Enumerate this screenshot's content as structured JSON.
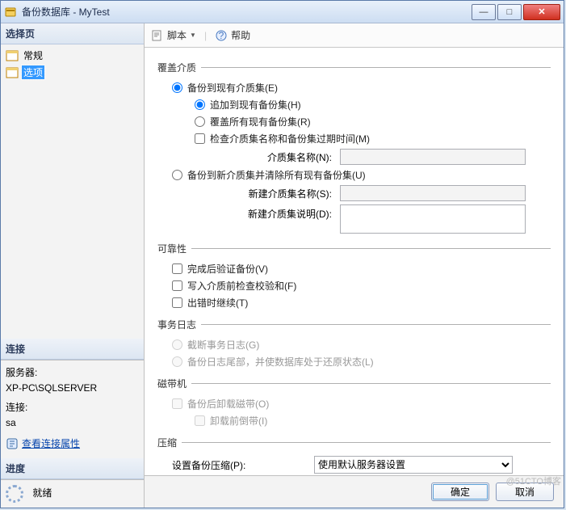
{
  "window": {
    "title": "备份数据库 - MyTest"
  },
  "sidebar": {
    "select_page": "选择页",
    "items": [
      {
        "label": "常规"
      },
      {
        "label": "选项"
      }
    ],
    "connection_hdr": "连接",
    "server_label": "服务器:",
    "server_value": "XP-PC\\SQLSERVER",
    "conn_label": "连接:",
    "conn_value": "sa",
    "view_props": "查看连接属性",
    "progress_hdr": "进度",
    "progress_status": "就绪"
  },
  "toolbar": {
    "script": "脚本",
    "help": "帮助"
  },
  "groups": {
    "overwrite": {
      "legend": "覆盖介质",
      "r_existing": "备份到现有介质集(E)",
      "r_append": "追加到现有备份集(H)",
      "r_overwrite_all": "覆盖所有现有备份集(R)",
      "chk_check_name": "检查介质集名称和备份集过期时间(M)",
      "lbl_media_name": "介质集名称(N):",
      "r_new_media": "备份到新介质集并清除所有现有备份集(U)",
      "lbl_new_media_name": "新建介质集名称(S):",
      "lbl_new_media_desc": "新建介质集说明(D):"
    },
    "reliability": {
      "legend": "可靠性",
      "chk_verify": "完成后验证备份(V)",
      "chk_checksum": "写入介质前检查校验和(F)",
      "chk_continue": "出错时继续(T)"
    },
    "txlog": {
      "legend": "事务日志",
      "r_truncate": "截断事务日志(G)",
      "r_backup_tail": "备份日志尾部，并使数据库处于还原状态(L)"
    },
    "tape": {
      "legend": "磁带机",
      "chk_unload": "备份后卸载磁带(O)",
      "chk_rewind": "卸载前倒带(I)"
    },
    "compress": {
      "legend": "压缩",
      "lbl_compress": "设置备份压缩(P):",
      "sel_compress": "使用默认服务器设置"
    }
  },
  "footer": {
    "ok": "确定",
    "cancel": "取消"
  },
  "watermark": "@51CTO博客"
}
